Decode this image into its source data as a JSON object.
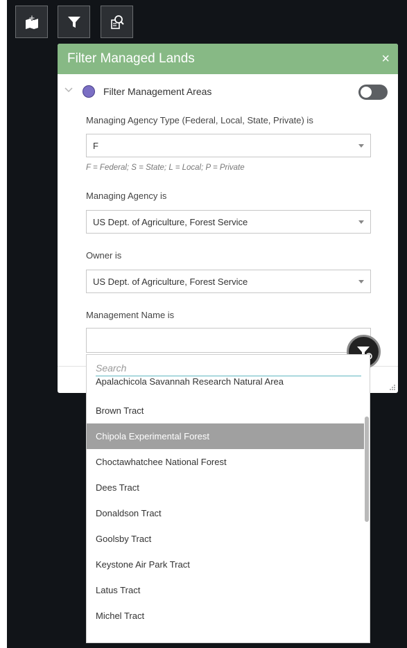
{
  "panel": {
    "title": "Filter Managed Lands",
    "close_label": "×"
  },
  "section": {
    "label": "Filter Management Areas",
    "toggle_on": false,
    "circle_color": "#7b6fc4"
  },
  "fields": {
    "agency_type": {
      "label": "Managing Agency Type (Federal, Local, State, Private) is",
      "value": "F",
      "hint": "F = Federal; S = State; L = Local; P = Private"
    },
    "agency": {
      "label": "Managing Agency is",
      "value": "US Dept. of Agriculture, Forest Service"
    },
    "owner": {
      "label": "Owner is",
      "value": "US Dept. of Agriculture, Forest Service"
    },
    "management_name": {
      "label": "Management Name is",
      "value": ""
    }
  },
  "dropdown": {
    "search_placeholder": "Search",
    "items": [
      "Apalachicola Savannah Research Natural Area",
      "Brown Tract",
      "Chipola Experimental Forest",
      "Choctawhatchee National Forest",
      "Dees Tract",
      "Donaldson Tract",
      "Goolsby Tract",
      "Keystone Air Park Tract",
      "Latus Tract",
      "Michel Tract"
    ],
    "selected_index": 2
  },
  "colors": {
    "header": "#87b985",
    "background": "#111418",
    "selected_row": "#a0a0a0",
    "search_underline": "#5fb7c0"
  },
  "icons": {
    "toolbar": [
      "add-data-icon",
      "filter-icon",
      "query-icon"
    ],
    "fab": "filter-settings-icon"
  }
}
